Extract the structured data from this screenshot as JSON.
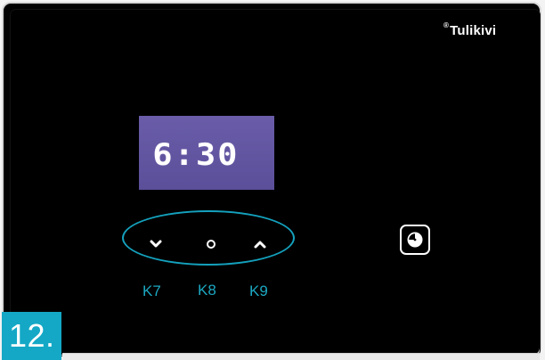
{
  "brand": {
    "mark": "®",
    "name": "Tulikivi"
  },
  "display": {
    "time": "6:30"
  },
  "keys": [
    {
      "id": "k7",
      "label": "K7",
      "icon": "chevron-down-icon"
    },
    {
      "id": "k8",
      "label": "K8",
      "icon": "dot-icon"
    },
    {
      "id": "k9",
      "label": "K9",
      "icon": "chevron-up-icon"
    }
  ],
  "timer_button": {
    "icon": "timer-icon"
  },
  "step": {
    "label": "12."
  },
  "colors": {
    "panel_background": "#000000",
    "display_background": "#5b4f9a",
    "accent": "#14a8c6",
    "icon": "#ffffff"
  }
}
